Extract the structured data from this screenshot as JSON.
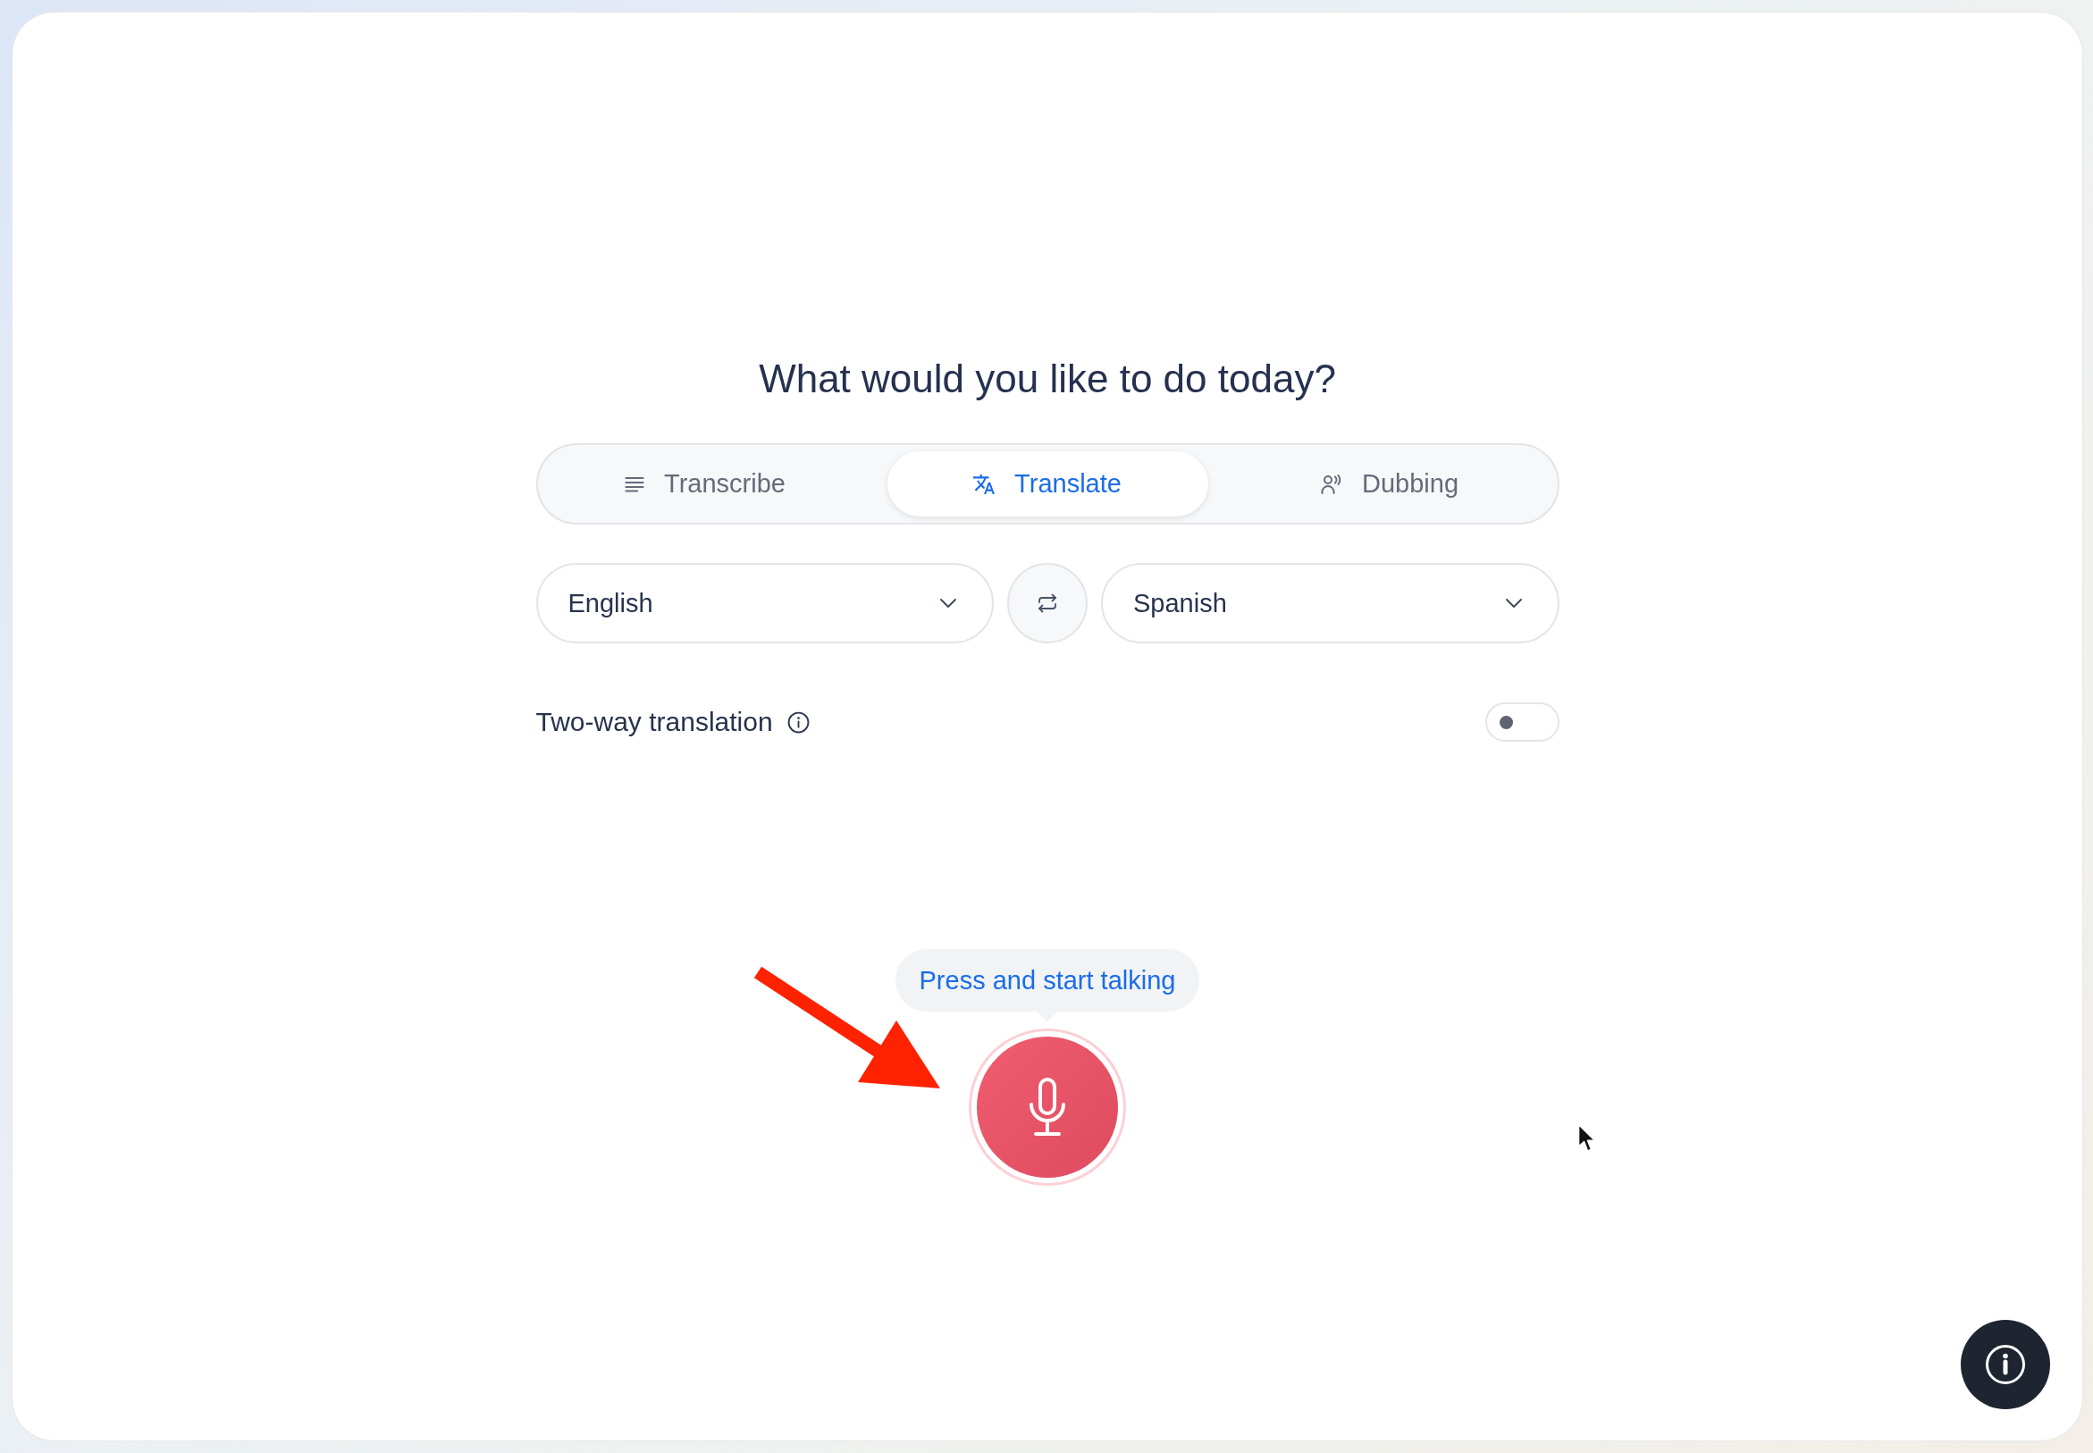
{
  "heading": "What would you like to do today?",
  "modes": [
    {
      "label": "Transcribe",
      "selected": false
    },
    {
      "label": "Translate",
      "selected": true
    },
    {
      "label": "Dubbing",
      "selected": false
    }
  ],
  "source_language": "English",
  "target_language": "Spanish",
  "two_way_translation": {
    "label": "Two-way translation",
    "on": false
  },
  "microphone": {
    "tooltip": "Press and start talking"
  }
}
